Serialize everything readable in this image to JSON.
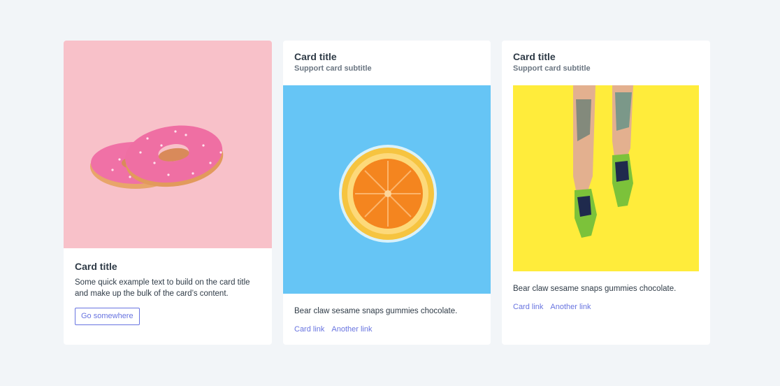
{
  "cards": [
    {
      "title": "Card title",
      "text": "Some quick example text to build on the card title and make up the bulk of the card’s content.",
      "button_label": "Go somewhere",
      "image": "pink-donuts-image"
    },
    {
      "title": "Card title",
      "subtitle": "Support card subtitle",
      "text": "Bear claw sesame snaps gummies chocolate.",
      "links": [
        "Card link",
        "Another link"
      ],
      "image": "orange-slice-in-glass-image"
    },
    {
      "title": "Card title",
      "subtitle": "Support card subtitle",
      "text": "Bear claw sesame snaps gummies chocolate.",
      "links": [
        "Card link",
        "Another link"
      ],
      "image": "legs-green-sneakers-image"
    }
  ],
  "colors": {
    "page_background": "#f2f5f8",
    "card_background": "#ffffff",
    "accent": "#6874e0",
    "donut_background": "#f8c1c9",
    "orange_background": "#66c5f5",
    "sneakers_background": "#ffec3b"
  }
}
